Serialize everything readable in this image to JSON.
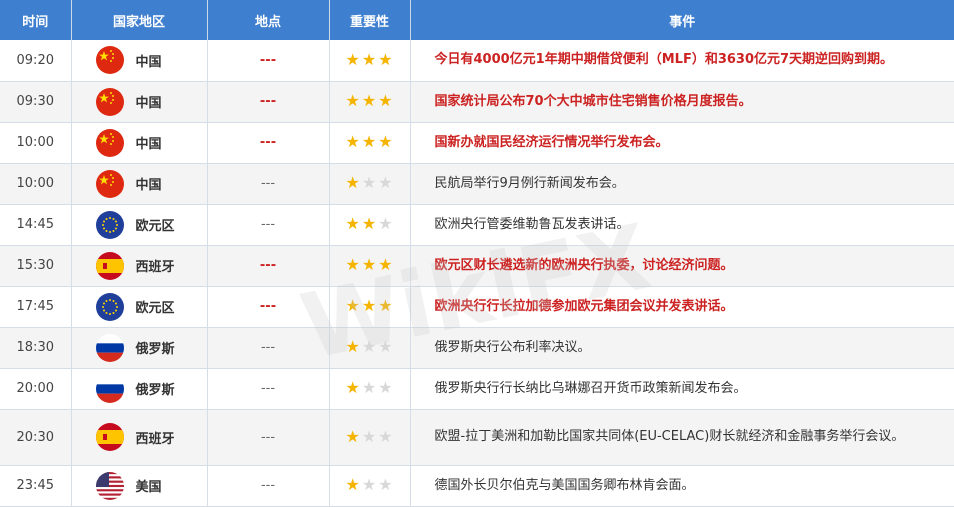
{
  "headers": {
    "time": "时间",
    "country": "国家地区",
    "place": "地点",
    "importance": "重要性",
    "event": "事件"
  },
  "watermark": "WikiFX",
  "rows": [
    {
      "time": "09:20",
      "country": "中国",
      "flag": "cn",
      "place": "---",
      "stars": 3,
      "important": true,
      "event": "今日有4000亿元1年期中期借贷便利（MLF）和3630亿元7天期逆回购到期。"
    },
    {
      "time": "09:30",
      "country": "中国",
      "flag": "cn",
      "place": "---",
      "stars": 3,
      "important": true,
      "event": "国家统计局公布70个大中城市住宅销售价格月度报告。"
    },
    {
      "time": "10:00",
      "country": "中国",
      "flag": "cn",
      "place": "---",
      "stars": 3,
      "important": true,
      "event": "国新办就国民经济运行情况举行发布会。"
    },
    {
      "time": "10:00",
      "country": "中国",
      "flag": "cn",
      "place": "---",
      "stars": 1,
      "important": false,
      "event": "民航局举行9月例行新闻发布会。"
    },
    {
      "time": "14:45",
      "country": "欧元区",
      "flag": "eu",
      "place": "---",
      "stars": 2,
      "important": false,
      "event": "欧洲央行管委维勒鲁瓦发表讲话。"
    },
    {
      "time": "15:30",
      "country": "西班牙",
      "flag": "es",
      "place": "---",
      "stars": 3,
      "important": true,
      "event": "欧元区财长遴选新的欧洲央行执委，讨论经济问题。"
    },
    {
      "time": "17:45",
      "country": "欧元区",
      "flag": "eu",
      "place": "---",
      "stars": 3,
      "important": true,
      "event": "欧洲央行行长拉加德参加欧元集团会议并发表讲话。"
    },
    {
      "time": "18:30",
      "country": "俄罗斯",
      "flag": "ru",
      "place": "---",
      "stars": 1,
      "important": false,
      "event": "俄罗斯央行公布利率决议。"
    },
    {
      "time": "20:00",
      "country": "俄罗斯",
      "flag": "ru",
      "place": "---",
      "stars": 1,
      "important": false,
      "event": "俄罗斯央行行长纳比乌琳娜召开货币政策新闻发布会。"
    },
    {
      "time": "20:30",
      "country": "西班牙",
      "flag": "es",
      "place": "---",
      "stars": 1,
      "important": false,
      "event": "欧盟-拉丁美洲和加勒比国家共同体(EU-CELAC)财长就经济和金融事务举行会议。"
    },
    {
      "time": "23:45",
      "country": "美国",
      "flag": "us",
      "place": "---",
      "stars": 1,
      "important": false,
      "event": "德国外长贝尔伯克与美国国务卿布林肯会面。"
    }
  ]
}
